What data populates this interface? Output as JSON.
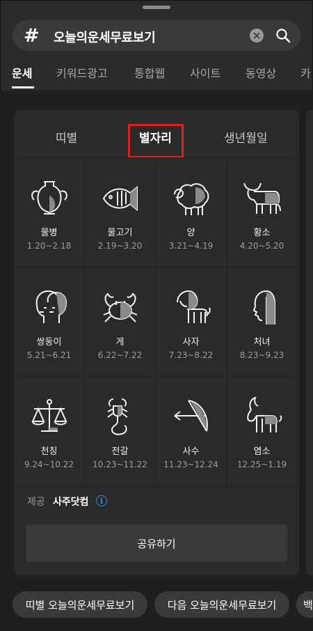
{
  "search": {
    "hash": "#",
    "query": "오늘의운세무료보기"
  },
  "tabs": [
    "운세",
    "키워드광고",
    "통합웹",
    "사이트",
    "동영상",
    "카"
  ],
  "sub_tabs": [
    "띠별",
    "별자리",
    "생년월일"
  ],
  "signs": [
    {
      "name": "물병",
      "date": "1.20~2.18",
      "icon": "aquarius-vase-icon"
    },
    {
      "name": "물고기",
      "date": "2.19~3.20",
      "icon": "pisces-fish-icon"
    },
    {
      "name": "양",
      "date": "3.21~4.19",
      "icon": "aries-sheep-icon"
    },
    {
      "name": "황소",
      "date": "4.20~5.20",
      "icon": "taurus-bull-icon"
    },
    {
      "name": "쌍둥이",
      "date": "5.21~6.21",
      "icon": "gemini-twins-icon"
    },
    {
      "name": "게",
      "date": "6.22~7.22",
      "icon": "cancer-crab-icon"
    },
    {
      "name": "사자",
      "date": "7.23~8.22",
      "icon": "leo-lion-icon"
    },
    {
      "name": "처녀",
      "date": "8.23~9.23",
      "icon": "virgo-maiden-icon"
    },
    {
      "name": "천칭",
      "date": "9.24~10.22",
      "icon": "libra-scales-icon"
    },
    {
      "name": "전갈",
      "date": "10.23~11.22",
      "icon": "scorpio-scorpion-icon"
    },
    {
      "name": "사수",
      "date": "11.23~12.24",
      "icon": "sagittarius-bow-icon"
    },
    {
      "name": "염소",
      "date": "12.25~1.19",
      "icon": "capricorn-goat-icon"
    }
  ],
  "provider": {
    "label": "제공",
    "name": "사주닷컴",
    "info": "i"
  },
  "share_label": "공유하기",
  "related_chips": [
    "띠별 오늘의운세무료보기",
    "다음 오늘의운세무료보기",
    "백"
  ],
  "colors": {
    "highlight": "#e21e1e",
    "info": "#3d84e6"
  }
}
